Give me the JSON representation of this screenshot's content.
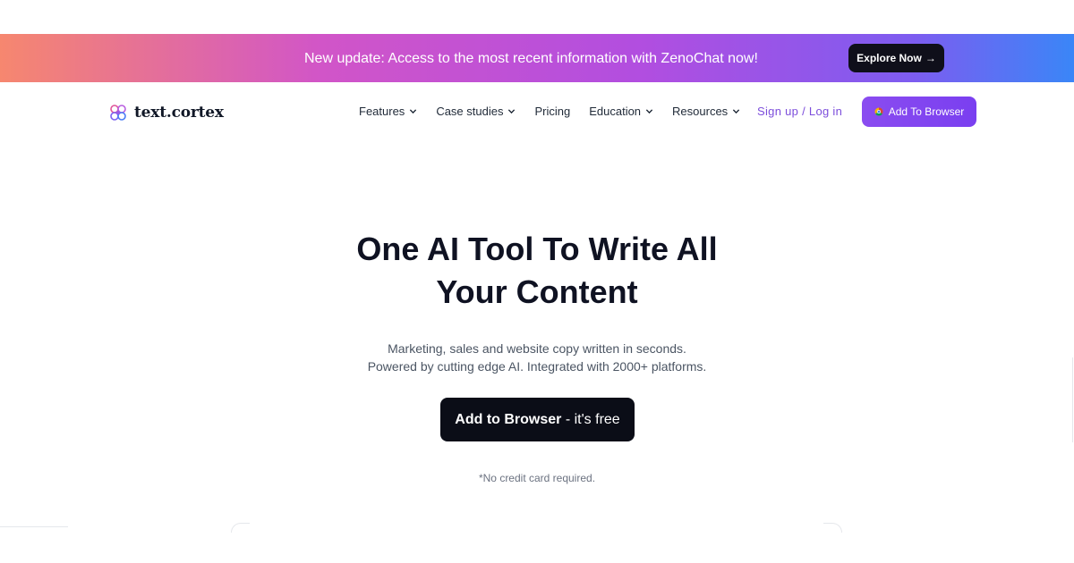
{
  "banner": {
    "text": "New update: Access to the most recent information with ZenoChat now!",
    "button_label": "Explore Now",
    "button_arrow": "→"
  },
  "nav": {
    "logo_text": "text.cortex",
    "items": [
      {
        "label": "Features",
        "has_dropdown": true
      },
      {
        "label": "Case studies",
        "has_dropdown": true
      },
      {
        "label": "Pricing",
        "has_dropdown": false
      },
      {
        "label": "Education",
        "has_dropdown": true
      },
      {
        "label": "Resources",
        "has_dropdown": true
      }
    ],
    "signup_label": "Sign up / Log in",
    "add_button_label": "Add To Browser"
  },
  "hero": {
    "title_line1": "One AI Tool To Write All",
    "title_line2": "Your Content",
    "sub_line1": "Marketing, sales and website copy written in seconds.",
    "sub_line2": "Powered by cutting edge AI. Integrated with 2000+ platforms.",
    "cta_strong": "Add to Browser",
    "cta_rest": " - it's free",
    "note": "*No credit card required."
  },
  "colors": {
    "accent": "#7c3aed",
    "dark": "#0b0d17",
    "link": "#7c4ddb"
  },
  "icons": {
    "logo": "brain-logo-icon",
    "dropdown": "chevron-down-icon",
    "arrow": "arrow-right-icon",
    "browser": "chrome-icon"
  }
}
